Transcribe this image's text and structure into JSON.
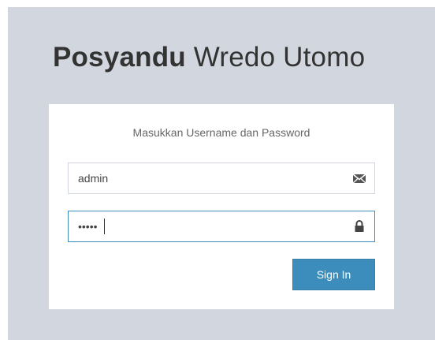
{
  "logo": {
    "bold_text": "Posyandu",
    "light_text": " Wredo Utomo"
  },
  "login": {
    "message": "Masukkan Username dan Password",
    "username": {
      "value": "admin",
      "icon": "envelope-icon"
    },
    "password": {
      "value": "•••••",
      "icon": "lock-icon",
      "focused": true
    },
    "submit_label": "Sign In"
  },
  "colors": {
    "page_background": "#d2d6de",
    "accent": "#3c8dbc",
    "box_background": "#ffffff"
  }
}
